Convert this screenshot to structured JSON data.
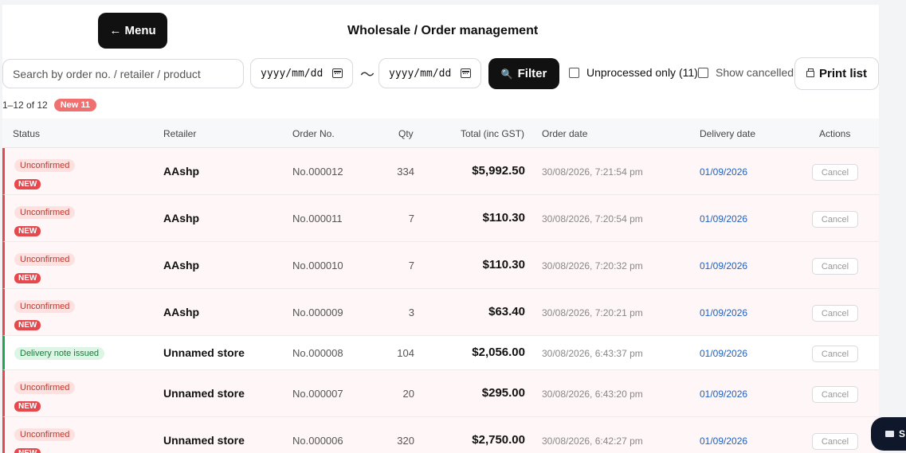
{
  "header": {
    "menu_label": "← Menu",
    "title": "Wholesale / Order management"
  },
  "toolbar": {
    "search_placeholder": "Search by order no. / retailer / product",
    "date_from_placeholder": "yyyy/mm/dd",
    "date_separator": "〜",
    "date_to_placeholder": "yyyy/mm/dd",
    "filter_label": "Filter",
    "unprocessed_label": "Unprocessed only (11)",
    "show_cancelled_label": "Show cancelled",
    "print_label": "Print list"
  },
  "meta": {
    "range": "1–12 of 12",
    "new_badge": "New 11"
  },
  "table": {
    "columns": [
      "Status",
      "Retailer",
      "Order No.",
      "Qty",
      "Total (inc GST)",
      "Order date",
      "Delivery date",
      "Actions"
    ],
    "cancel_label": "Cancel",
    "new_label": "NEW",
    "rows": [
      {
        "status": "Unconfirmed",
        "is_new": true,
        "retailer": "AAshp",
        "order_no": "No.000012",
        "qty": "334",
        "total": "$5,992.50",
        "order_date": "30/08/2026, 7:21:54 pm",
        "delivery_date": "01/09/2026"
      },
      {
        "status": "Unconfirmed",
        "is_new": true,
        "retailer": "AAshp",
        "order_no": "No.000011",
        "qty": "7",
        "total": "$110.30",
        "order_date": "30/08/2026, 7:20:54 pm",
        "delivery_date": "01/09/2026"
      },
      {
        "status": "Unconfirmed",
        "is_new": true,
        "retailer": "AAshp",
        "order_no": "No.000010",
        "qty": "7",
        "total": "$110.30",
        "order_date": "30/08/2026, 7:20:32 pm",
        "delivery_date": "01/09/2026"
      },
      {
        "status": "Unconfirmed",
        "is_new": true,
        "retailer": "AAshp",
        "order_no": "No.000009",
        "qty": "3",
        "total": "$63.40",
        "order_date": "30/08/2026, 7:20:21 pm",
        "delivery_date": "01/09/2026"
      },
      {
        "status": "Delivery note issued",
        "is_new": false,
        "retailer": "Unnamed store",
        "order_no": "No.000008",
        "qty": "104",
        "total": "$2,056.00",
        "order_date": "30/08/2026, 6:43:37 pm",
        "delivery_date": "01/09/2026"
      },
      {
        "status": "Unconfirmed",
        "is_new": true,
        "retailer": "Unnamed store",
        "order_no": "No.000007",
        "qty": "20",
        "total": "$295.00",
        "order_date": "30/08/2026, 6:43:20 pm",
        "delivery_date": "01/09/2026"
      },
      {
        "status": "Unconfirmed",
        "is_new": true,
        "retailer": "Unnamed store",
        "order_no": "No.000006",
        "qty": "320",
        "total": "$2,750.00",
        "order_date": "30/08/2026, 6:42:27 pm",
        "delivery_date": "01/09/2026"
      }
    ]
  },
  "floating_button": {
    "label": "S"
  },
  "colors": {
    "unconfirmed_stripe": "#e5484d",
    "issued_stripe": "#22a35a",
    "delivery_date": "#1f5fbf",
    "primary_button": "#111111"
  }
}
